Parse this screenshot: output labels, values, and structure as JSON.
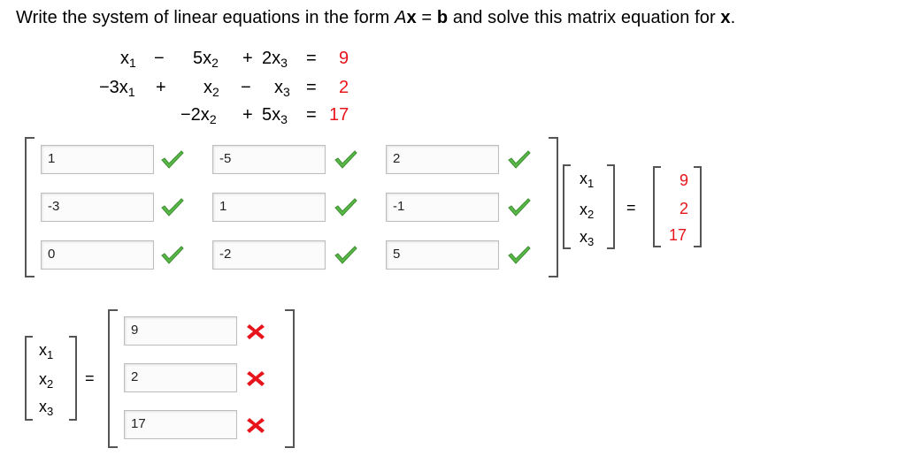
{
  "prompt": {
    "pre": "Write the system of linear equations in the form ",
    "A": "A",
    "x": "x",
    "eqsign": " = ",
    "b": "b",
    "mid": " and solve this matrix equation for ",
    "xend": "x",
    "end": "."
  },
  "equations": {
    "row1": {
      "c1": "x",
      "s1": "1",
      "op1": "−",
      "c2": "5x",
      "s2": "2",
      "op2": "+",
      "c3": "2x",
      "s3": "3",
      "eq": "=",
      "rhs": "9"
    },
    "row2": {
      "c1": "−3x",
      "s1": "1",
      "op1": "+",
      "c2": "x",
      "s2": "2",
      "op2": "−",
      "c3": "x",
      "s3": "3",
      "eq": "=",
      "rhs": "2"
    },
    "row3": {
      "c2": "−2x",
      "s2": "2",
      "op2": "+",
      "c3": "5x",
      "s3": "3",
      "eq": "=",
      "rhs": "17"
    }
  },
  "matrix_A": [
    [
      "1",
      "-5",
      "2"
    ],
    [
      "-3",
      "1",
      "-1"
    ],
    [
      "0",
      "-2",
      "5"
    ]
  ],
  "x_vector": {
    "v": "x",
    "subs": [
      "1",
      "2",
      "3"
    ]
  },
  "b_vector": [
    "9",
    "2",
    "17"
  ],
  "equals": "=",
  "solution": [
    "9",
    "2",
    "17"
  ],
  "colors": {
    "correct": "#4caf50",
    "incorrect": "#e8141b",
    "constant": "#e8141b"
  },
  "icons": {
    "correct": "check-icon",
    "incorrect": "x-mark-icon"
  }
}
